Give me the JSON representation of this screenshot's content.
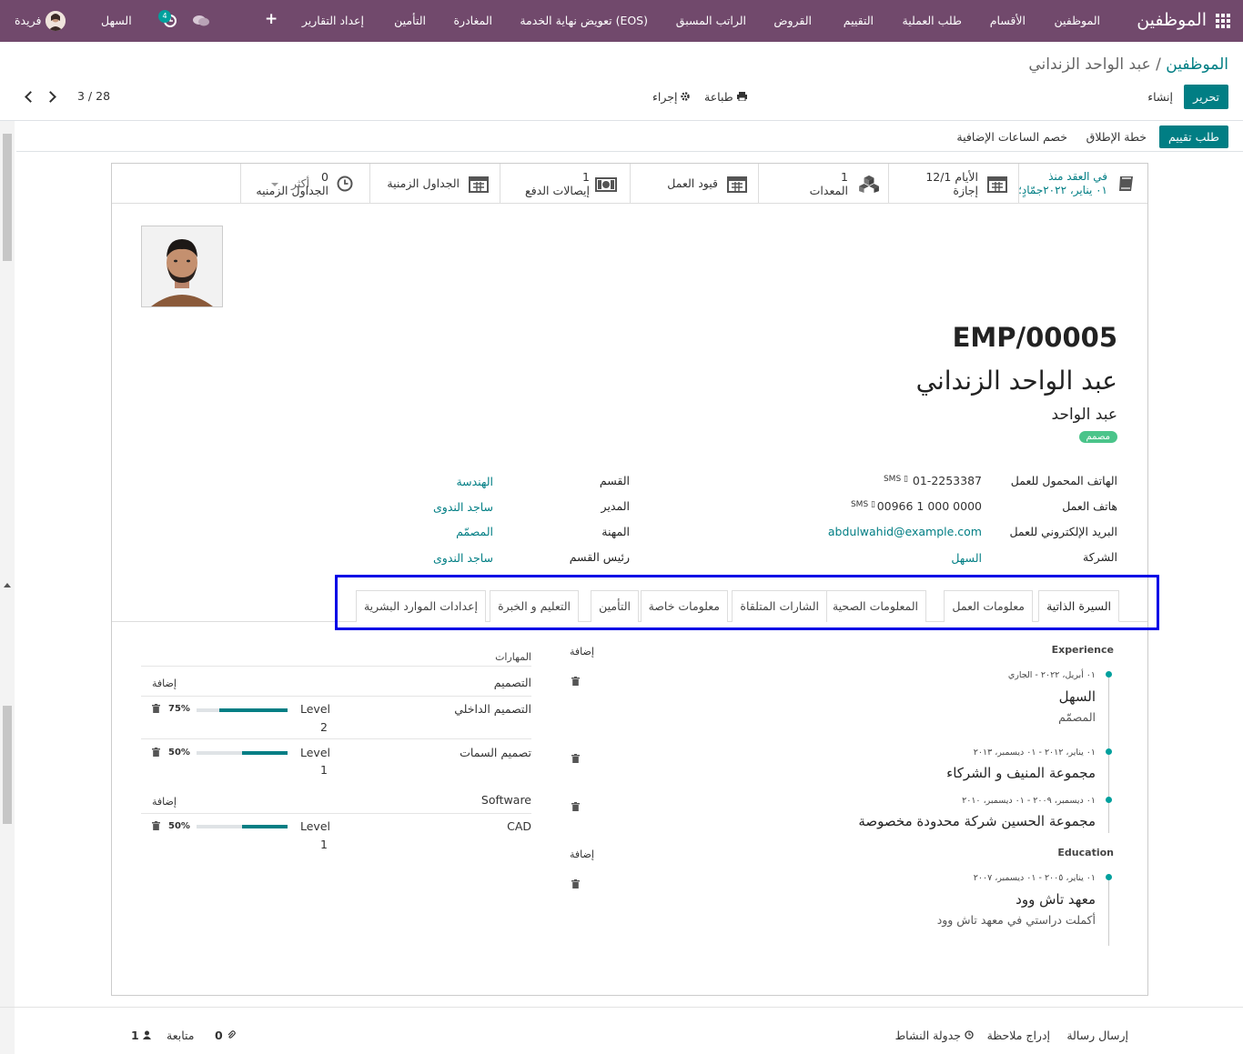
{
  "navbar": {
    "app_title": "الموظفين",
    "menus": [
      "الموظفين",
      "الأقسام",
      "طلب العملية",
      "التقييم",
      "القروض",
      "الراتب المسبق",
      "تعويض نهاية الخدمة (EOS)",
      "المغادرة",
      "التأمين",
      "إعداد التقارير"
    ],
    "plus": "+",
    "activity_count": "4",
    "company": "السهل",
    "user": "فريدة"
  },
  "control_panel": {
    "breadcrumb_root": "الموظفين",
    "breadcrumb_sep": "/",
    "breadcrumb_current": "عبد الواحد الزنداني",
    "edit_button": "تحرير",
    "create_button": "إنشاء",
    "print_button": "طباعة",
    "action_button": "إجراء",
    "pager": "3 / 28"
  },
  "statusbar": {
    "buttons": [
      "طلب تقييم",
      "خطة الإطلاق",
      "خصم الساعات الإضافية"
    ]
  },
  "smart_buttons": {
    "contract_line1": "في العقد منذ",
    "contract_line2": "٠١ يناير، ٢٠٢٢جمّادٍ؛",
    "leave_value": "12/1 الأيام",
    "leave_label": "إجازة",
    "equipment_value": "1",
    "equipment_label": "المعدات",
    "work_entries_label": "قيود العمل",
    "payslips_value": "1",
    "payslips_label": "إيصالات الدفع",
    "timesheets_label": "الجداول الزمنية",
    "timesheets2_value": "0",
    "timesheets2_label": "الجداول الزمنيه",
    "more_label": "أكثر"
  },
  "employee": {
    "code": "EMP/00005",
    "name": "عبد الواحد الزنداني",
    "job_title": "عبد الواحد",
    "tag": "مصمم"
  },
  "fields_right": [
    {
      "label": "الهاتف المحمول للعمل",
      "value": "01-2253387",
      "sms": "SMS"
    },
    {
      "label": "هاتف العمل",
      "value": "00966 1 000 0000",
      "sms": "SMS"
    },
    {
      "label": "البريد الإلكتروني للعمل",
      "value": "abdulwahid@example.com"
    },
    {
      "label": "الشركة",
      "value": "السهل"
    }
  ],
  "fields_left": [
    {
      "label": "القسم",
      "value": "الهندسة"
    },
    {
      "label": "المدير",
      "value": "ساجد الندوى"
    },
    {
      "label": "المهنة",
      "value": "المصمّم"
    },
    {
      "label": "رئيس القسم",
      "value": "ساجد الندوى"
    }
  ],
  "tabs": [
    "السيرة الذاتية",
    "معلومات العمل",
    "المعلومات الصحية",
    "الشارات المتلقاة",
    "معلومات خاصة",
    "التأمين",
    "التعليم و الخبرة",
    "إعدادات الموارد البشرية"
  ],
  "resume": {
    "add_label": "إضافة",
    "experience_title": "Experience",
    "education_title": "Education",
    "experience": [
      {
        "dates": "٠١ أبريل، ٢٠٢٢ - الجاري",
        "name": "السهل",
        "desc": "المصمّم"
      },
      {
        "dates": "٠١ يناير، ٢٠١٢ - ٠١ ديسمبر، ٢٠١٣",
        "name": "مجموعة المنيف و الشركاء",
        "desc": ""
      },
      {
        "dates": "٠١ ديسمبر، ٢٠٠٩ - ٠١ ديسمبر، ٢٠١٠",
        "name": "مجموعة الحسين شركة محدودة مخصوصة",
        "desc": ""
      }
    ],
    "education": [
      {
        "dates": "٠١ يناير، ٢٠٠٥ - ٠١ ديسمبر، ٢٠٠٧",
        "name": "معهد تاش وود",
        "desc": "أكملت دراستي في معهد تاش وود"
      }
    ]
  },
  "skills": {
    "title": "المهارات",
    "add_label": "إضافة",
    "level_label": "Level",
    "groups": [
      {
        "name": "التصميم",
        "items": [
          {
            "name": "التصميم الداخلي",
            "level": "2",
            "progress": "75%",
            "fraction": 0.75
          },
          {
            "name": "تصميم السمات",
            "level": "1",
            "progress": "50%",
            "fraction": 0.5
          }
        ]
      },
      {
        "name": "Software",
        "items": [
          {
            "name": "CAD",
            "level": "1",
            "progress": "50%",
            "fraction": 0.5
          }
        ]
      }
    ]
  },
  "chatter": {
    "send_message": "إرسال رسالة",
    "log_note": "إدراج ملاحظة",
    "schedule_activity": "جدولة النشاط",
    "attachments_count": "0",
    "follow": "متابعة",
    "followers_count": "1"
  },
  "colors": {
    "navbar": "#71496c",
    "primary": "#017e84",
    "accent": "#00a09d",
    "highlight": "#0000e6"
  }
}
